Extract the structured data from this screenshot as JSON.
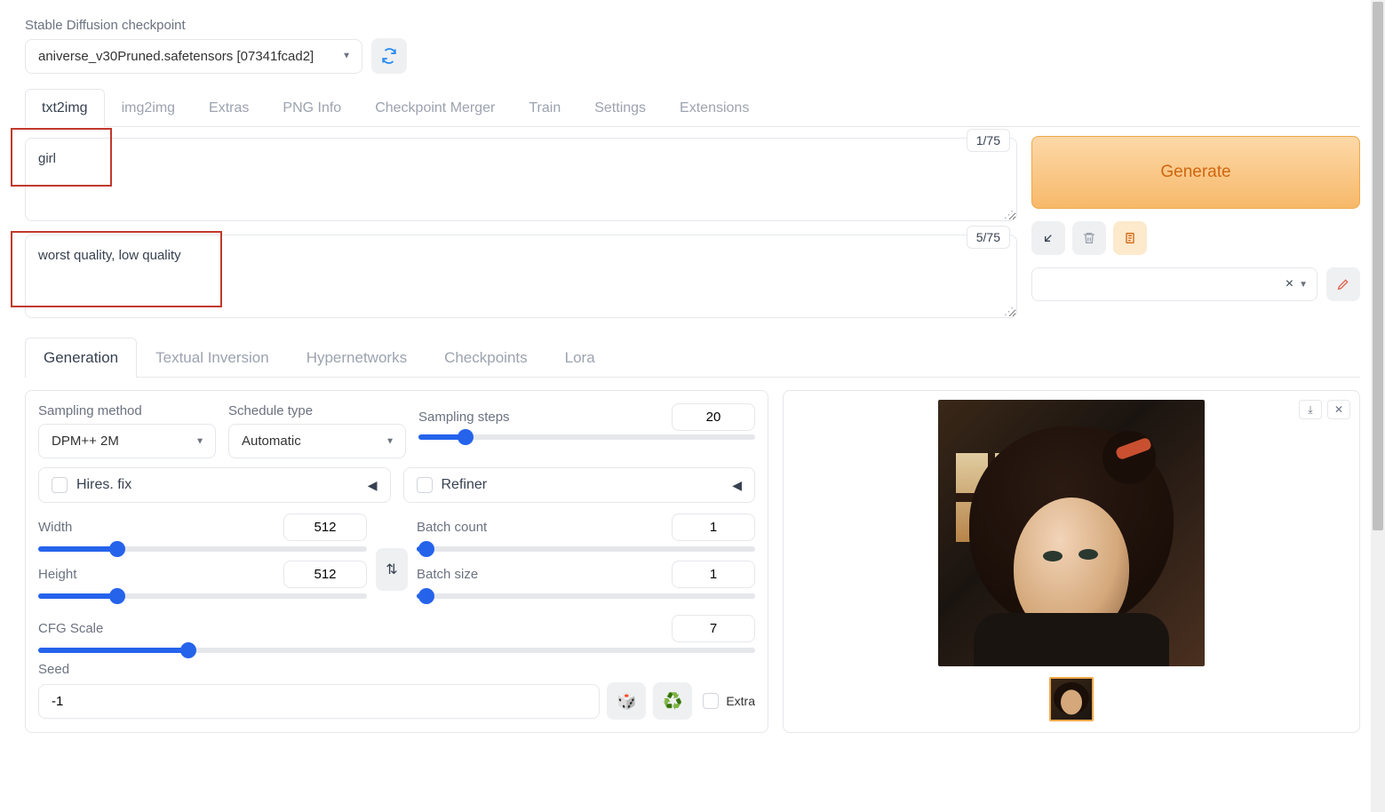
{
  "checkpoint": {
    "label": "Stable Diffusion checkpoint",
    "value": "aniverse_v30Pruned.safetensors [07341fcad2]"
  },
  "main_tabs": [
    "txt2img",
    "img2img",
    "Extras",
    "PNG Info",
    "Checkpoint Merger",
    "Train",
    "Settings",
    "Extensions"
  ],
  "active_main_tab": 0,
  "prompt": {
    "value": "girl",
    "tokens": "1/75"
  },
  "negative_prompt": {
    "value": "worst quality, low quality",
    "tokens": "5/75"
  },
  "generate_label": "Generate",
  "sub_tabs": [
    "Generation",
    "Textual Inversion",
    "Hypernetworks",
    "Checkpoints",
    "Lora"
  ],
  "active_sub_tab": 0,
  "sampling": {
    "method_label": "Sampling method",
    "method_value": "DPM++ 2M",
    "schedule_label": "Schedule type",
    "schedule_value": "Automatic",
    "steps_label": "Sampling steps",
    "steps_value": "20",
    "steps_pct": 14
  },
  "hires": {
    "label": "Hires. fix"
  },
  "refiner": {
    "label": "Refiner"
  },
  "width": {
    "label": "Width",
    "value": "512",
    "pct": 24
  },
  "height": {
    "label": "Height",
    "value": "512",
    "pct": 24
  },
  "batch_count": {
    "label": "Batch count",
    "value": "1",
    "pct": 3
  },
  "batch_size": {
    "label": "Batch size",
    "value": "1",
    "pct": 3
  },
  "cfg": {
    "label": "CFG Scale",
    "value": "7",
    "pct": 21
  },
  "seed": {
    "label": "Seed",
    "value": "-1",
    "extra_label": "Extra"
  },
  "swap_glyph": "⇅"
}
